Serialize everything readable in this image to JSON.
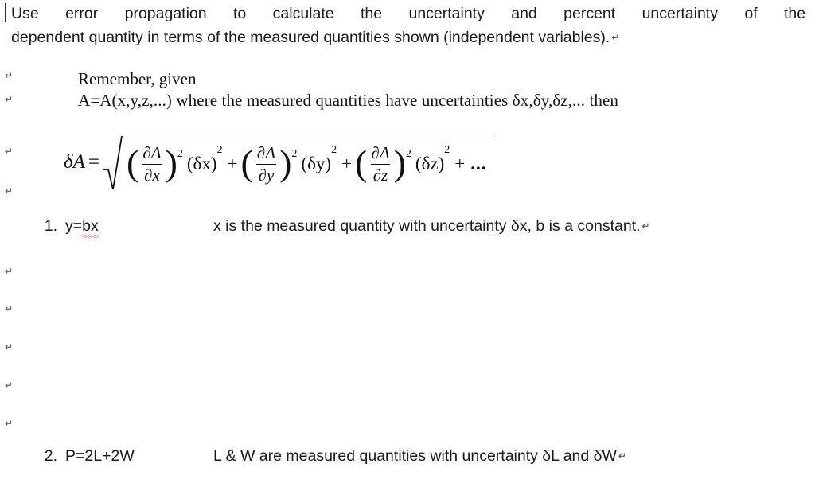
{
  "document": {
    "intro": {
      "line1_words": [
        "Use",
        "error",
        "propagation",
        "to",
        "calculate",
        "the",
        "uncertainty",
        "and",
        "percent",
        "uncertainty",
        "of",
        "the"
      ],
      "line2": "dependent quantity in terms of the measured quantities shown (independent variables)."
    },
    "remember": {
      "line1": "Remember, given",
      "line2": "A=A(x,y,z,...) where the measured quantities have uncertainties δx,δy,δz,... then"
    },
    "formula": {
      "lhs": "δA",
      "equals": "=",
      "terms": [
        {
          "numerator": "∂A",
          "denominator": "∂x",
          "power": "2",
          "delta": "(δx)",
          "delta_power": "2"
        },
        {
          "numerator": "∂A",
          "denominator": "∂y",
          "power": "2",
          "delta": "(δy)",
          "delta_power": "2"
        },
        {
          "numerator": "∂A",
          "denominator": "∂z",
          "power": "2",
          "delta": "(δz)",
          "delta_power": "2"
        }
      ],
      "plus": "+",
      "ellipsis": "..."
    },
    "problems": [
      {
        "number": "1.",
        "expression_prefix": "y=",
        "expression_spell": "bx",
        "description": "x is the measured quantity with uncertainty δx, b is a constant.",
        "return_mark": "↵"
      },
      {
        "number": "2.",
        "expression": "P=2L+2W",
        "description": "L & W are measured quantities with uncertainty δL and δW",
        "return_mark": "↵"
      }
    ],
    "return_marks": [
      "↵",
      "↵",
      "↵",
      "↵",
      "↵",
      "↵",
      "↵",
      "↵",
      "↵"
    ],
    "intro_return_mark": "↵",
    "colors": {
      "text": "#1a1a1a",
      "mark": "#3a3a6a",
      "spellcheck": "#e04a4a",
      "background": "#ffffff"
    }
  }
}
